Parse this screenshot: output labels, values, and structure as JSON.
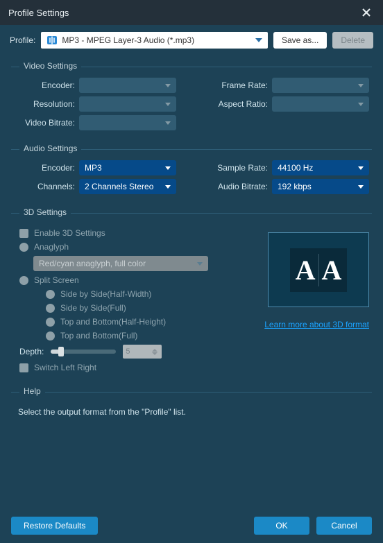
{
  "window": {
    "title": "Profile Settings"
  },
  "toolbar": {
    "profile_label": "Profile:",
    "profile_value": "MP3 - MPEG Layer-3 Audio (*.mp3)",
    "save_as": "Save as...",
    "delete": "Delete"
  },
  "video": {
    "title": "Video Settings",
    "encoder_label": "Encoder:",
    "encoder_value": "",
    "resolution_label": "Resolution:",
    "resolution_value": "",
    "video_bitrate_label": "Video Bitrate:",
    "video_bitrate_value": "",
    "frame_rate_label": "Frame Rate:",
    "frame_rate_value": "",
    "aspect_ratio_label": "Aspect Ratio:",
    "aspect_ratio_value": ""
  },
  "audio": {
    "title": "Audio Settings",
    "encoder_label": "Encoder:",
    "encoder_value": "MP3",
    "channels_label": "Channels:",
    "channels_value": "2 Channels Stereo",
    "sample_rate_label": "Sample Rate:",
    "sample_rate_value": "44100 Hz",
    "audio_bitrate_label": "Audio Bitrate:",
    "audio_bitrate_value": "192 kbps"
  },
  "threeD": {
    "title": "3D Settings",
    "enable": "Enable 3D Settings",
    "anaglyph": "Anaglyph",
    "anaglyph_mode": "Red/cyan anaglyph, full color",
    "split_screen": "Split Screen",
    "side_half": "Side by Side(Half-Width)",
    "side_full": "Side by Side(Full)",
    "tb_half": "Top and Bottom(Half-Height)",
    "tb_full": "Top and Bottom(Full)",
    "depth_label": "Depth:",
    "depth_value": "5",
    "switch_lr": "Switch Left Right",
    "learn_more": "Learn more about 3D format"
  },
  "help": {
    "title": "Help",
    "text": "Select the output format from the \"Profile\" list."
  },
  "footer": {
    "restore": "Restore Defaults",
    "ok": "OK",
    "cancel": "Cancel"
  }
}
